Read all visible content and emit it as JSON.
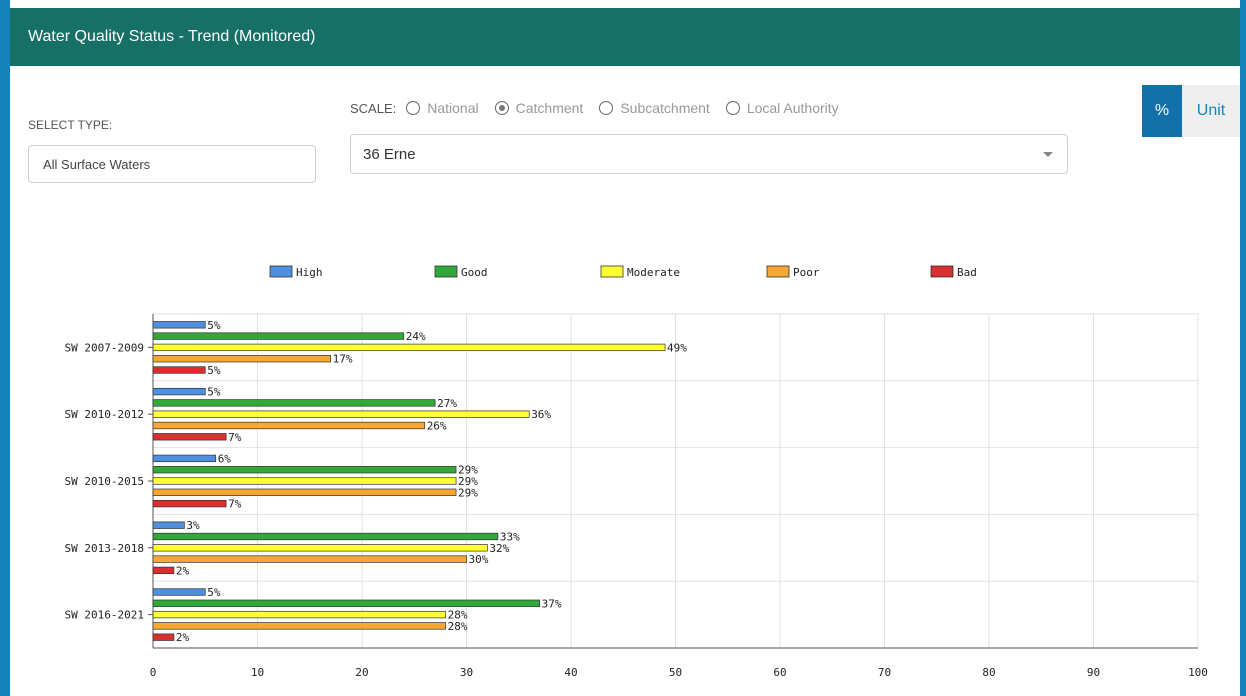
{
  "header": {
    "title": "Water Quality Status - Trend (Monitored)"
  },
  "filters": {
    "select_type_label": "SELECT TYPE:",
    "type_value": "All Surface Waters",
    "scale_label": "SCALE:",
    "scale_options": [
      "National",
      "Catchment",
      "Subcatchment",
      "Local Authority"
    ],
    "scale_selected": "Catchment",
    "catchment_value": "36 Erne"
  },
  "toggle": {
    "percent_label": "%",
    "unit_label": "Unit",
    "selected": "%"
  },
  "chart_data": {
    "type": "bar",
    "orientation": "horizontal",
    "categories": [
      "SW 2007-2009",
      "SW 2010-2012",
      "SW 2010-2015",
      "SW 2013-2018",
      "SW 2016-2021"
    ],
    "series": [
      {
        "name": "High",
        "color": "#4f8fe0",
        "values": [
          5,
          5,
          6,
          3,
          5
        ]
      },
      {
        "name": "Good",
        "color": "#33a83a",
        "values": [
          24,
          27,
          29,
          33,
          37
        ]
      },
      {
        "name": "Moderate",
        "color": "#ffff33",
        "values": [
          49,
          36,
          29,
          32,
          28
        ]
      },
      {
        "name": "Poor",
        "color": "#f8a733",
        "values": [
          17,
          26,
          29,
          30,
          28
        ]
      },
      {
        "name": "Bad",
        "color": "#d9302f",
        "values": [
          5,
          7,
          7,
          2,
          2
        ]
      }
    ],
    "labels": [
      [
        "5%",
        "5%",
        "6%",
        "3%",
        "5%"
      ],
      [
        "24%",
        "27%",
        "29%",
        "33%",
        "37%"
      ],
      [
        "49%",
        "36%",
        "29%",
        "32%",
        "28%"
      ],
      [
        "17%",
        "26%",
        "29%",
        "30%",
        "28%"
      ],
      [
        "5%",
        "7%",
        "7%",
        "2%",
        "2%"
      ]
    ],
    "xticks": [
      "0",
      "10",
      "20",
      "30",
      "40",
      "50",
      "60",
      "70",
      "80",
      "90",
      "100"
    ],
    "xlim": [
      0,
      100
    ],
    "grid": true,
    "legend_position": "top"
  }
}
